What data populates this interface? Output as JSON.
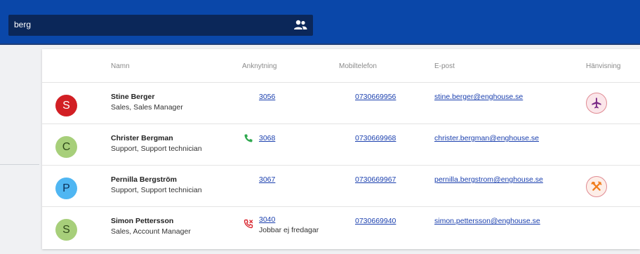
{
  "search": {
    "query": "berg",
    "icon": "people-icon"
  },
  "table": {
    "columns": [
      "Namn",
      "Anknytning",
      "Mobiltelefon",
      "E-post",
      "Hänvisning"
    ],
    "rows": [
      {
        "initial": "S",
        "avatar_color": "#d21f24",
        "avatar_text_color": "#ffffff",
        "name": "Stine Berger",
        "dept": "Sales, Sales Manager",
        "ext": "3056",
        "ext_icon": "",
        "ext_note": "",
        "mobile": "0730669956",
        "email": "stine.berger@enghouse.se",
        "referral": "airplane-icon"
      },
      {
        "initial": "C",
        "avatar_color": "#a7cf7a",
        "avatar_text_color": "#2f4a1a",
        "name": "Christer Bergman",
        "dept": "Support, Support technician",
        "ext": "3068",
        "ext_icon": "phone-icon",
        "ext_note": "",
        "mobile": "0730669968",
        "email": "christer.bergman@enghouse.se",
        "referral": ""
      },
      {
        "initial": "P",
        "avatar_color": "#4fb6f2",
        "avatar_text_color": "#0b2f56",
        "name": "Pernilla Bergström",
        "dept": "Support, Support technician",
        "ext": "3067",
        "ext_icon": "",
        "ext_note": "",
        "mobile": "0730669967",
        "email": "pernilla.bergstrom@enghouse.se",
        "referral": "lunch-icon"
      },
      {
        "initial": "S",
        "avatar_color": "#a7cf7a",
        "avatar_text_color": "#2f4a1a",
        "name": "Simon Pettersson",
        "dept": "Sales, Account Manager",
        "ext": "3040",
        "ext_icon": "phone-off-icon",
        "ext_note": "Jobbar ej fredagar",
        "mobile": "0730669940",
        "email": "simon.pettersson@enghouse.se",
        "referral": ""
      }
    ]
  },
  "colors": {
    "topbar": "#0a47a9",
    "search_bg": "#0b2759",
    "link": "#1a3fae",
    "phone_green": "#2fa84f",
    "phone_red": "#d9262f",
    "badge_plane_bg": "#fbe6ea",
    "badge_plane_fg": "#7a2a86",
    "badge_lunch_bg": "#fdeee8",
    "badge_lunch_fg": "#f07d1c"
  }
}
